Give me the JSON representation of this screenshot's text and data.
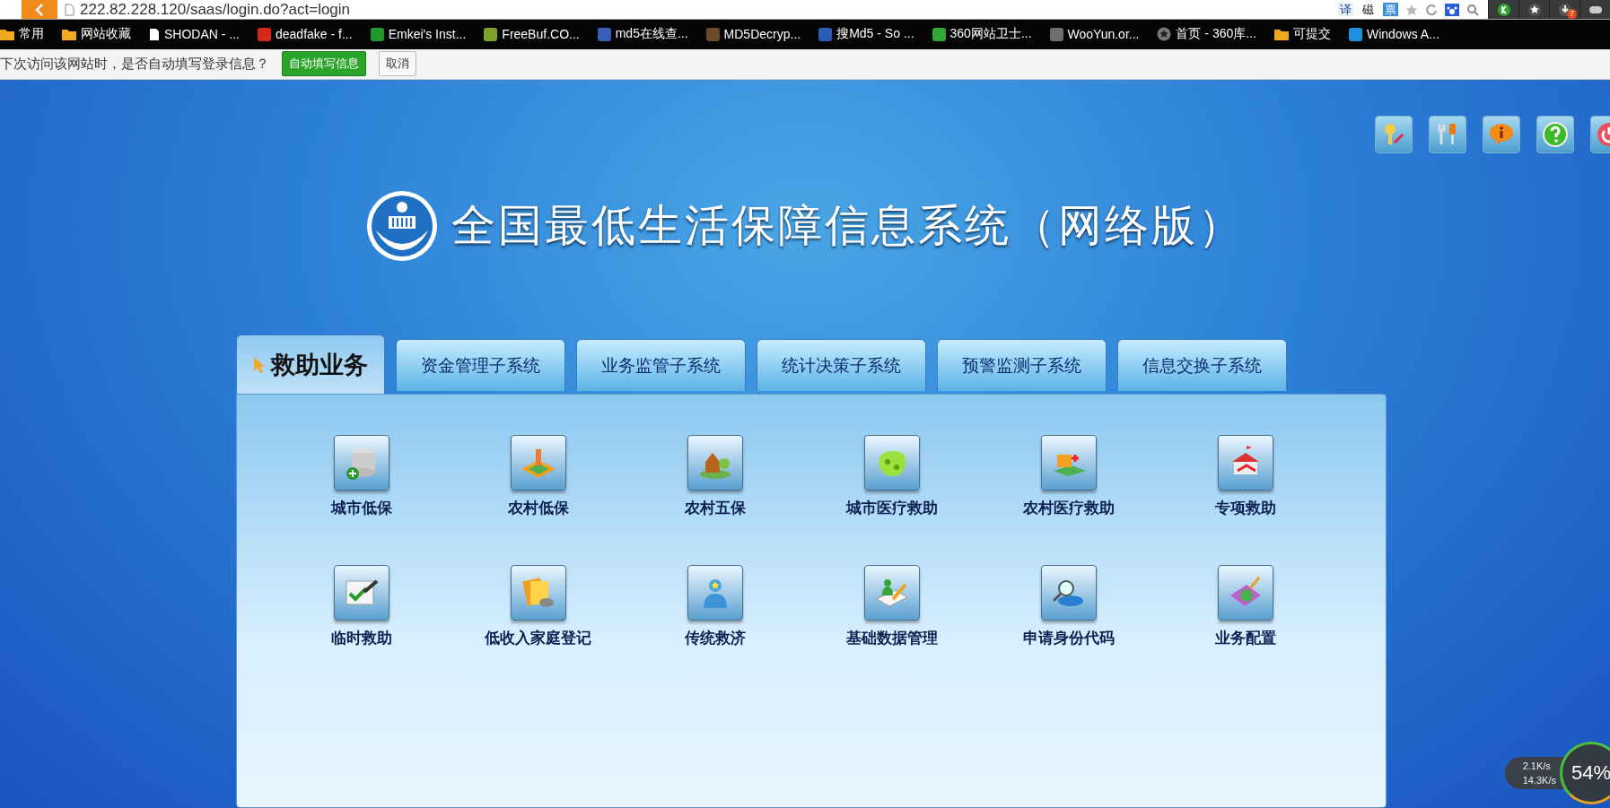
{
  "browser": {
    "url": "222.82.228.120/saas/login.do?act=login",
    "extension_labels": [
      "译",
      "磁",
      "票"
    ],
    "download_badge": "7",
    "bookmarks": [
      {
        "label": "常用",
        "kind": "folder"
      },
      {
        "label": "网站收藏",
        "kind": "folder"
      },
      {
        "label": "SHODAN - ...",
        "kind": "page"
      },
      {
        "label": "deadfake - f...",
        "kind": "logo",
        "color": "#d42a1e"
      },
      {
        "label": "Emkei's Inst...",
        "kind": "logo",
        "color": "#1f9a2a"
      },
      {
        "label": "FreeBuf.CO...",
        "kind": "logo",
        "color": "#7da32a"
      },
      {
        "label": "md5在线查...",
        "kind": "logo",
        "color": "#3b5fb8"
      },
      {
        "label": "MD5Decryp...",
        "kind": "logo",
        "color": "#6b4a2a"
      },
      {
        "label": "搜Md5 - So ...",
        "kind": "logo",
        "color": "#2a5cb8"
      },
      {
        "label": "360网站卫士...",
        "kind": "logo",
        "color": "#2fa838"
      },
      {
        "label": "WooYun.or...",
        "kind": "logo",
        "color": "#6f6f6f"
      },
      {
        "label": "首页 - 360库...",
        "kind": "star"
      },
      {
        "label": "可提交",
        "kind": "folder"
      },
      {
        "label": "Windows A...",
        "kind": "logo",
        "color": "#1e90e0"
      }
    ],
    "autofill": {
      "message": "下次访问该网站时，是否自动填写登录信息？",
      "accept": "自动填写信息",
      "cancel": "取消"
    }
  },
  "app": {
    "title": "全国最低生活保障信息系统（网络版）"
  },
  "tabs": [
    {
      "label": "救助业务",
      "selected": true
    },
    {
      "label": "资金管理子系统",
      "selected": false
    },
    {
      "label": "业务监管子系统",
      "selected": false
    },
    {
      "label": "统计决策子系统",
      "selected": false
    },
    {
      "label": "预警监测子系统",
      "selected": false
    },
    {
      "label": "信息交换子系统",
      "selected": false
    }
  ],
  "modules": [
    {
      "label": "城市低保"
    },
    {
      "label": "农村低保"
    },
    {
      "label": "农村五保"
    },
    {
      "label": "城市医疗救助"
    },
    {
      "label": "农村医疗救助"
    },
    {
      "label": "专项救助"
    },
    {
      "label": "临时救助"
    },
    {
      "label": "低收入家庭登记"
    },
    {
      "label": "传统救济"
    },
    {
      "label": "基础数据管理"
    },
    {
      "label": "申请身份代码"
    },
    {
      "label": "业务配置"
    }
  ],
  "net_widget": {
    "upload": "2.1K/s",
    "download": "14.3K/s",
    "cpu": "54%"
  }
}
